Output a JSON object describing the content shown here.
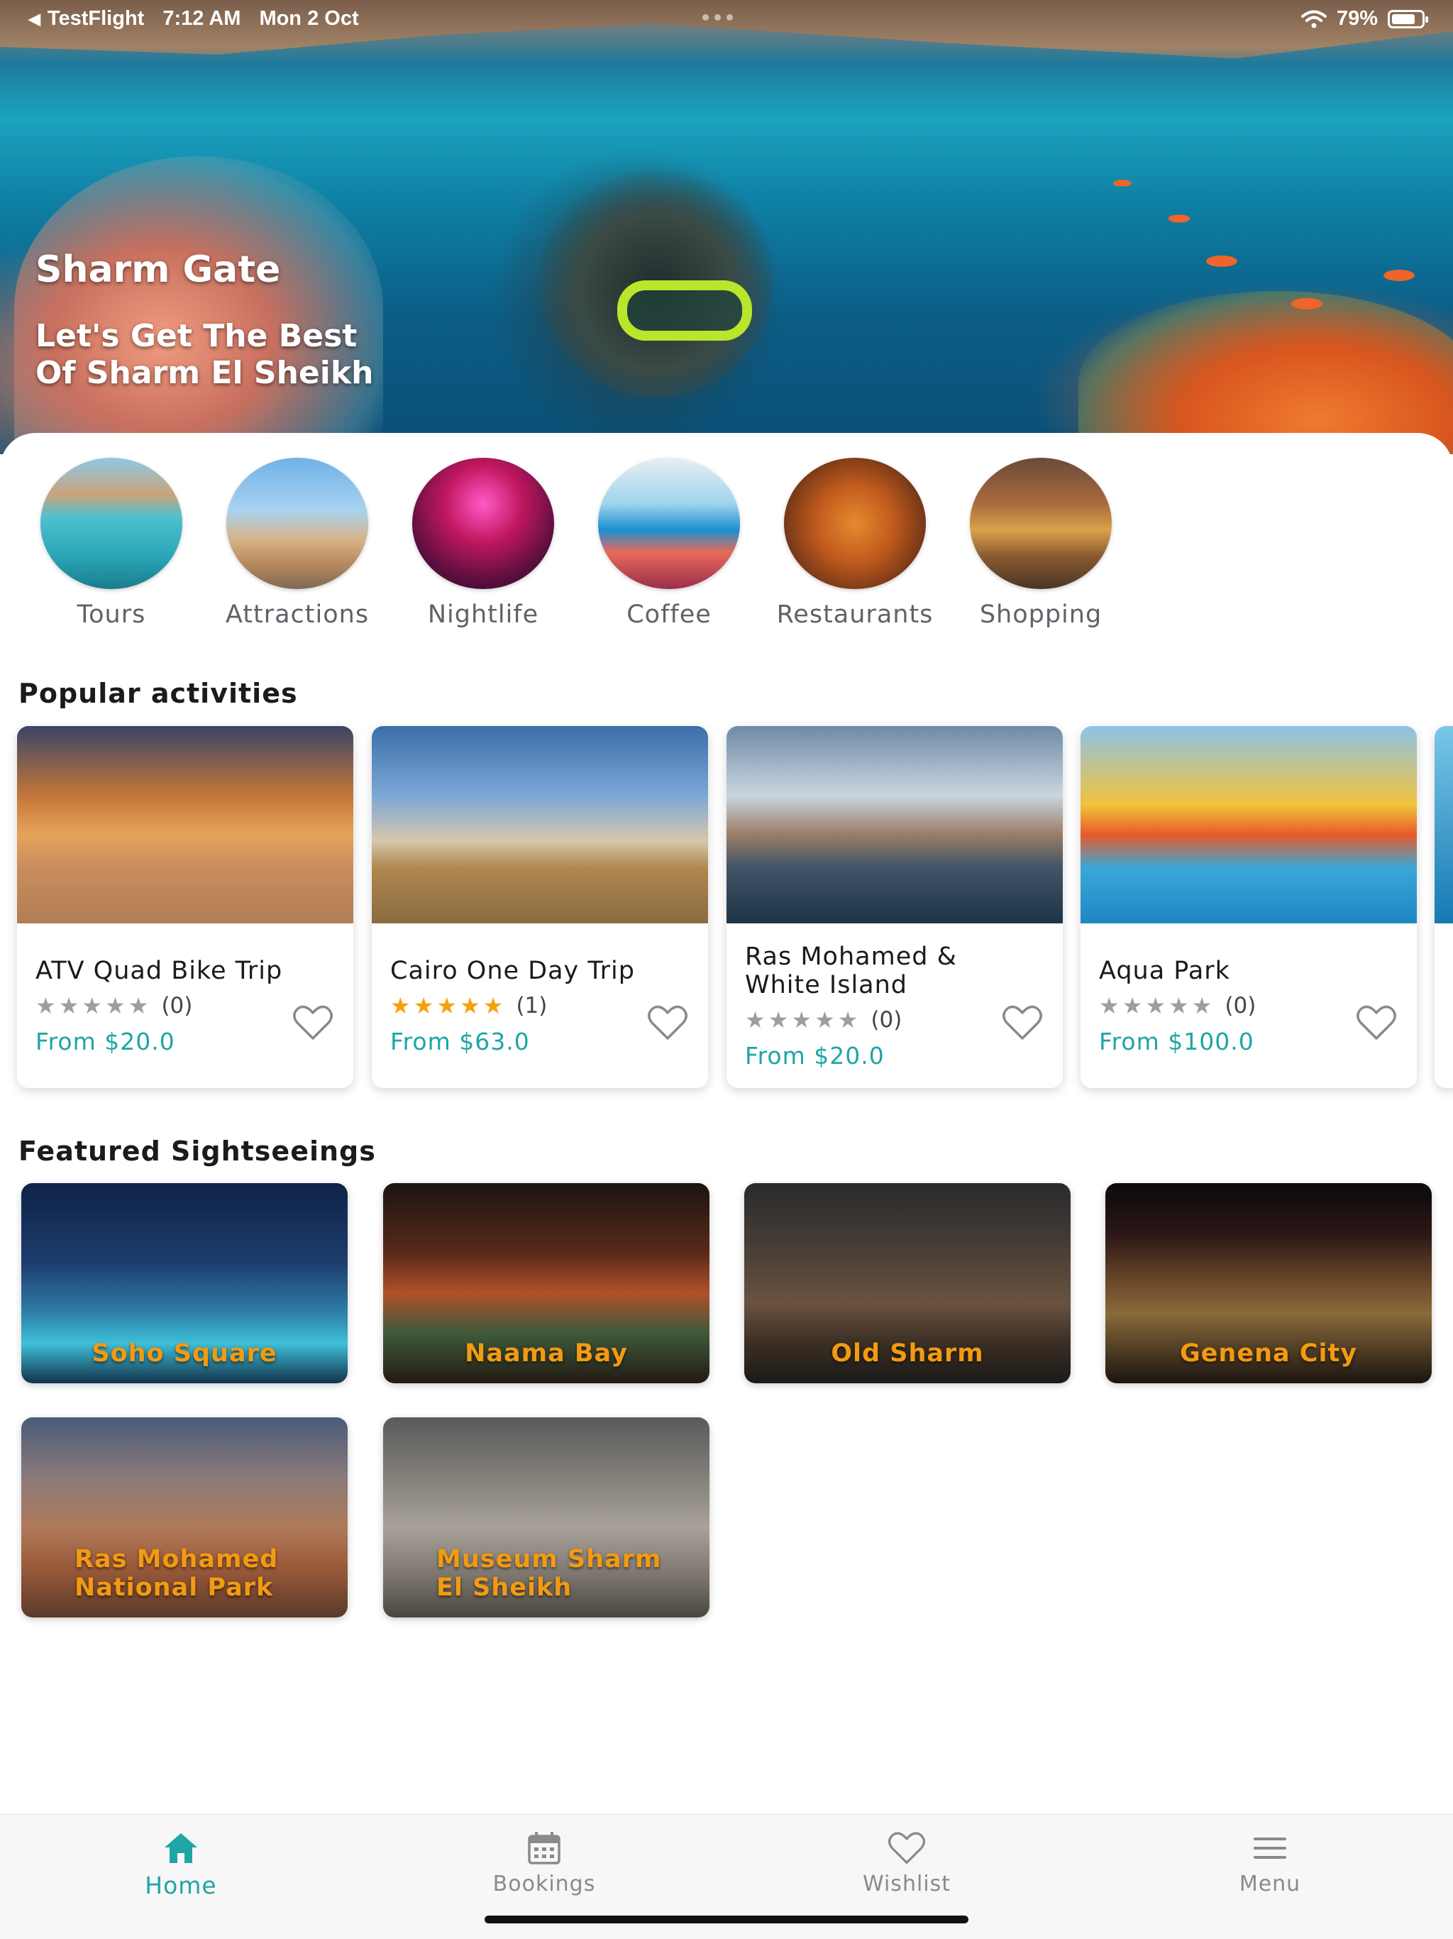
{
  "status_bar": {
    "back_app": "TestFlight",
    "time": "7:12 AM",
    "date": "Mon 2 Oct",
    "battery": "79%",
    "battery_level": 0.79
  },
  "hero": {
    "title": "Sharm Gate",
    "subtitle": "Let's Get The Best\nOf Sharm El Sheikh"
  },
  "categories": [
    {
      "label": "Tours"
    },
    {
      "label": "Attractions"
    },
    {
      "label": "Nightlife"
    },
    {
      "label": "Coffee"
    },
    {
      "label": "Restaurants"
    },
    {
      "label": "Shopping"
    }
  ],
  "popular": {
    "title": "Popular activities",
    "items": [
      {
        "title": "ATV Quad Bike Trip",
        "rating": 0,
        "reviews": "(0)",
        "price": "From $20.0"
      },
      {
        "title": "Cairo One Day Trip",
        "rating": 5,
        "reviews": "(1)",
        "price": "From $63.0"
      },
      {
        "title": "Ras Mohamed & White Island",
        "rating": 0,
        "reviews": "(0)",
        "price": "From $20.0"
      },
      {
        "title": "Aqua Park",
        "rating": 0,
        "reviews": "(0)",
        "price": "From $100.0"
      }
    ]
  },
  "featured": {
    "title": "Featured Sightseeings",
    "items": [
      {
        "label": "Soho Square"
      },
      {
        "label": "Naama Bay"
      },
      {
        "label": "Old Sharm"
      },
      {
        "label": "Genena City"
      },
      {
        "label": "Ras Mohamed\nNational Park"
      },
      {
        "label": "Museum Sharm\nEl Sheikh"
      }
    ]
  },
  "tabs": [
    {
      "label": "Home",
      "icon": "home-icon",
      "active": true
    },
    {
      "label": "Bookings",
      "icon": "calendar-icon",
      "active": false
    },
    {
      "label": "Wishlist",
      "icon": "heart-icon",
      "active": false
    },
    {
      "label": "Menu",
      "icon": "menu-icon",
      "active": false
    }
  ],
  "colors": {
    "accent": "#1ea5a5",
    "star_filled": "#f5a20a",
    "star_empty": "#9e9e9e",
    "sight_label": "#f29a12"
  }
}
